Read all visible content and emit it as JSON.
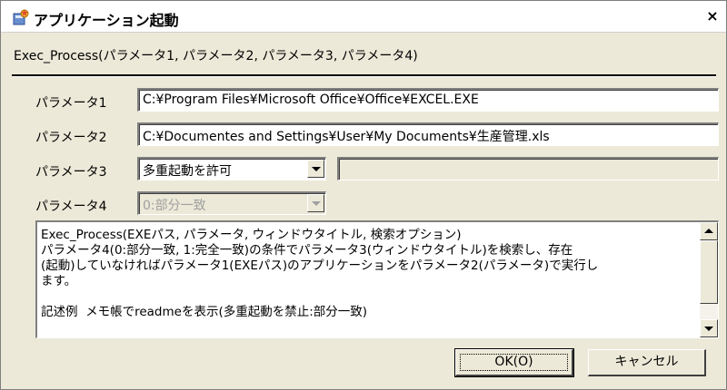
{
  "window": {
    "title": "アプリケーション起動",
    "close_glyph": "×"
  },
  "function_signature": "Exec_Process(パラメータ1, パラメータ2, パラメータ3, パラメータ4)",
  "params": {
    "p1": {
      "label": "パラメータ1",
      "value": "C:¥Program Files¥Microsoft Office¥Office¥EXCEL.EXE"
    },
    "p2": {
      "label": "パラメータ2",
      "value": "C:¥Documentes and Settings¥User¥My Documents¥生産管理.xls"
    },
    "p3": {
      "label": "パラメータ3",
      "value": "多重起動を許可",
      "extra_value": ""
    },
    "p4": {
      "label": "パラメータ4",
      "value": "0:部分一致"
    }
  },
  "description": "Exec_Process(EXEパス, パラメータ, ウィンドウタイトル, 検索オプション)\nパラメータ4(0:部分一致, 1:完全一致)の条件でパラメータ3(ウィンドウタイトル)を検索し、存在\n(起動)していなければパラメータ1(EXEパス)のアプリケーションをパラメータ2(パラメータ)で実行し\nます。\n\n記述例  メモ帳でreadmeを表示(多重起動を禁止:部分一致)",
  "buttons": {
    "ok": "OK(O)",
    "cancel": "キャンセル"
  },
  "icons": {
    "app": "app-launch-icon",
    "close": "close-icon"
  }
}
